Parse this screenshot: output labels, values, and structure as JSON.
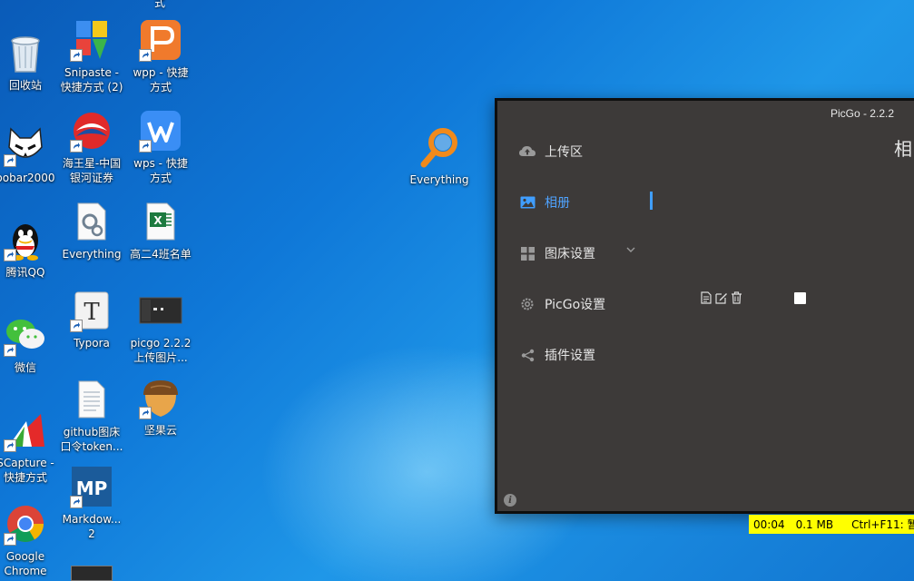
{
  "desktop": {
    "top_partial_label": "式",
    "icons": [
      {
        "label": "回收站",
        "icon": "recycle-bin-icon",
        "shortcut": false
      },
      {
        "label": "oobar2000",
        "icon": "foobar2000-icon",
        "shortcut": true
      },
      {
        "label": "腾讯QQ",
        "icon": "qq-penguin-icon",
        "shortcut": true
      },
      {
        "label": "微信",
        "icon": "wechat-icon",
        "shortcut": true
      },
      {
        "label": "SCapture -\n快捷方式",
        "icon": "fscapture-icon",
        "shortcut": true
      },
      {
        "label": "Google\nChrome",
        "icon": "chrome-icon",
        "shortcut": true
      },
      {
        "label": "Snipaste -\n快捷方式 (2)",
        "icon": "snipaste-icon",
        "shortcut": true
      },
      {
        "label": "海王星-中国\n银河证券",
        "icon": "neptune-icon",
        "shortcut": true
      },
      {
        "label": "Everything",
        "icon": "settings-file-icon",
        "shortcut": false
      },
      {
        "label": "Typora",
        "icon": "typora-icon",
        "shortcut": true
      },
      {
        "label": "github图床\n口令token...",
        "icon": "text-file-icon",
        "shortcut": false
      },
      {
        "label": "Markdow...\n2",
        "icon": "markdown-icon",
        "shortcut": true
      },
      {
        "label": "wpp - 快捷\n方式",
        "icon": "wpp-icon",
        "shortcut": true
      },
      {
        "label": "wps - 快捷\n方式",
        "icon": "wps-icon",
        "shortcut": true
      },
      {
        "label": "高二4班名单",
        "icon": "excel-icon",
        "shortcut": false
      },
      {
        "label": "picgo 2.2.2\n上传图片...",
        "icon": "image-thumbnail-icon",
        "shortcut": false
      },
      {
        "label": "坚果云",
        "icon": "nutstore-icon",
        "shortcut": true
      },
      {
        "label": "Everything",
        "icon": "magnifier-icon",
        "shortcut": false
      }
    ]
  },
  "picgo": {
    "title": "PicGo - 2.2.2",
    "heading": "相",
    "nav": [
      {
        "label": "上传区",
        "icon": "cloud-upload-icon",
        "active": false
      },
      {
        "label": "相册",
        "icon": "image-icon",
        "active": true
      },
      {
        "label": "图床设置",
        "icon": "grid-icon",
        "active": false
      },
      {
        "label": "PicGo设置",
        "icon": "gear-icon",
        "active": false
      },
      {
        "label": "插件设置",
        "icon": "share-icon",
        "active": false
      }
    ],
    "info": "i"
  },
  "status_bar": {
    "time": "00:04",
    "size": "0.1 MB",
    "hint": "Ctrl+F11: 暂"
  },
  "colors": {
    "picgo_bg": "#3d3a39",
    "accent": "#409eff",
    "status_bg": "#ffff00"
  }
}
